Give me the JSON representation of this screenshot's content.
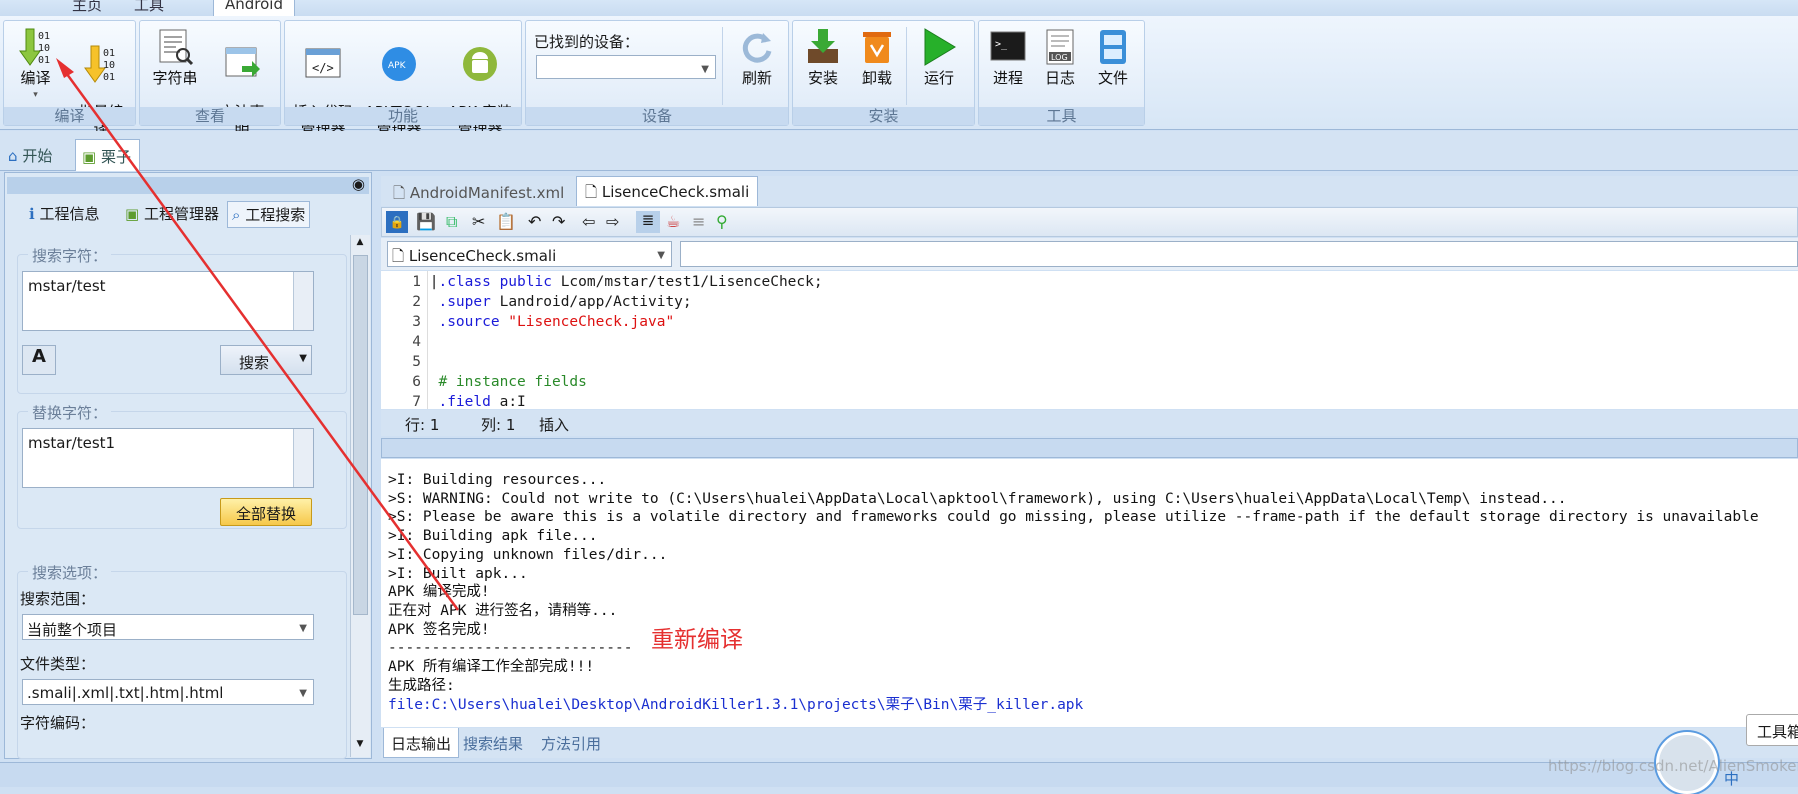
{
  "ribbon_tabs": [
    "主页",
    "工具",
    "Android"
  ],
  "groups": {
    "compile": {
      "label": "编译",
      "buttons": [
        "编译",
        "批量编\n译"
      ]
    },
    "view": {
      "label": "查看",
      "buttons": [
        "字符串",
        "方法声\n明"
      ]
    },
    "func": {
      "label": "功能",
      "buttons": [
        "插入代码\n管理器",
        "APKTOOL\n管理器",
        "APK 安装\n管理器"
      ]
    },
    "device": {
      "label": "设备",
      "found_label": "已找到的设备：",
      "device_value": "",
      "refresh": "刷新"
    },
    "install": {
      "label": "安装",
      "buttons": [
        "安装",
        "卸载",
        "运行"
      ]
    },
    "tools": {
      "label": "工具",
      "buttons": [
        "进程",
        "日志",
        "文件"
      ]
    }
  },
  "doc_tabs": [
    "开始",
    "栗子"
  ],
  "left_tabs": [
    "工程信息",
    "工程管理器",
    "工程搜索"
  ],
  "search": {
    "legend": "搜索字符：",
    "value": "mstar/test",
    "button": "搜索"
  },
  "replace": {
    "legend": "替换字符：",
    "value": "mstar/test1",
    "button": "全部替换"
  },
  "options": {
    "legend": "搜索选项：",
    "scope_label": "搜索范围：",
    "scope_value": "当前整个项目",
    "type_label": "文件类型：",
    "type_value": ".smali|.xml|.txt|.htm|.html",
    "enc_label": "字符编码："
  },
  "editor_tabs": [
    "AndroidManifest.xml",
    "LisenceCheck.smali"
  ],
  "file_combo": "LisenceCheck.smali",
  "code_lines": [
    {
      "n": "1",
      "k": ".class public",
      "r": " Lcom/mstar/test1/LisenceCheck;"
    },
    {
      "n": "2",
      "k": ".super",
      "r": " Landroid/app/Activity;"
    },
    {
      "n": "3",
      "k": ".source",
      "s": " \"LisenceCheck.java\""
    },
    {
      "n": "4"
    },
    {
      "n": "5"
    },
    {
      "n": "6",
      "c": "# instance fields"
    },
    {
      "n": "7",
      "k": ".field",
      "r": " a:I"
    }
  ],
  "status": {
    "row": "行: 1",
    "col": "列: 1",
    "mode": "插入"
  },
  "log_lines": [
    "I: Building resources...",
    "S: WARNING: Could not write to (C:\\Users\\hualei\\AppData\\Local\\apktool\\framework), using C:\\Users\\hualei\\AppData\\Local\\Temp\\ instead...",
    "S: Please be aware this is a volatile directory and frameworks could go missing, please utilize --frame-path if the default storage directory is unavailable",
    "I: Building apk file...",
    "I: Copying unknown files/dir...",
    "I: Built apk...",
    "APK 编译完成!",
    "正在对 APK 进行签名，请稍等...",
    "APK 签名完成!",
    "----------------------------",
    "APK 所有编译工作全部完成!!!",
    "生成路径:"
  ],
  "log_path": "file:C:\\Users\\hualei\\Desktop\\AndroidKiller1.3.1\\projects\\栗子\\Bin\\栗子_killer.apk",
  "bottom_tabs": [
    "日志输出",
    "搜索结果",
    "方法引用"
  ],
  "annotation": "重新编译",
  "tooltip": "工具箱",
  "watermark": "https://blog.csdn.net/AlienSmoker",
  "tray": "中"
}
